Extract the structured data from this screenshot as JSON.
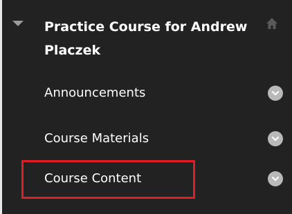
{
  "course_menu": {
    "title": "Practice Course for Andrew Placzek",
    "items": [
      {
        "label": "Announcements"
      },
      {
        "label": "Course Materials"
      },
      {
        "label": "Course Content",
        "highlighted": true
      }
    ]
  },
  "colors": {
    "panel_background": "#222222",
    "text": "#ffffff",
    "icon": "#b9b9b9",
    "highlight_border": "#e11d25"
  },
  "icons": {
    "collapse": "triangle-down-icon",
    "home": "home-icon",
    "item_menu": "chevron-down-circle-icon"
  }
}
